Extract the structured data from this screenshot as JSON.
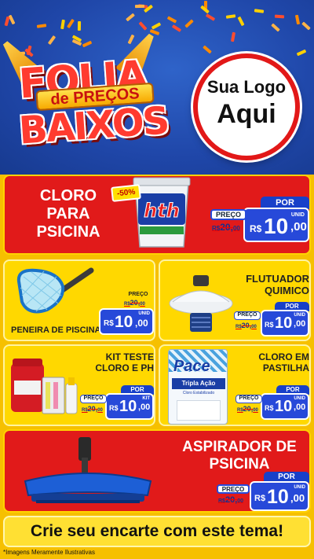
{
  "header": {
    "title_line1": "FOLIA",
    "title_ribbon": "de PREÇOS",
    "title_line2": "BAIXOS",
    "logo_line1": "Sua Logo",
    "logo_line2": "Aqui"
  },
  "products": [
    {
      "name_lines": [
        "CLORO",
        "PARA",
        "PSICINA"
      ],
      "discount": "-50%",
      "tag": {
        "por": "POR",
        "preco": "PREÇO",
        "old_currency": "R$",
        "old_int": "20",
        "old_dec": "00",
        "new_currency": "R$",
        "new_int": "10",
        "new_dec": "00",
        "unit": "UNID"
      },
      "colors": {
        "panel": "#e11a1a",
        "text": "#ffffff"
      }
    },
    {
      "name_lines": [
        "PENEIRA DE PISCINA"
      ],
      "tag": {
        "por": "POR",
        "preco": "PREÇO",
        "old_currency": "R$",
        "old_int": "20",
        "old_dec": "00",
        "new_currency": "R$",
        "new_int": "10",
        "new_dec": "00",
        "unit": "UNID"
      }
    },
    {
      "name_lines": [
        "FLUTUADOR",
        "QUIMICO"
      ],
      "tag": {
        "por": "POR",
        "preco": "PREÇO",
        "old_currency": "R$",
        "old_int": "20",
        "old_dec": "00",
        "new_currency": "R$",
        "new_int": "10",
        "new_dec": "00",
        "unit": "UNID"
      }
    },
    {
      "name_lines": [
        "KIT TESTE",
        "CLORO E PH"
      ],
      "tag": {
        "por": "POR",
        "preco": "PREÇO",
        "old_currency": "R$",
        "old_int": "20",
        "old_dec": "00",
        "new_currency": "R$",
        "new_int": "10",
        "new_dec": "00",
        "unit": "KIT"
      }
    },
    {
      "name_lines": [
        "CLORO EM",
        "PASTILHA"
      ],
      "tag": {
        "por": "POR",
        "preco": "PREÇO",
        "old_currency": "R$",
        "old_int": "20",
        "old_dec": "00",
        "new_currency": "R$",
        "new_int": "10",
        "new_dec": "00",
        "unit": "UNID"
      },
      "package": {
        "brand": "Pace",
        "line1": "Tripla Ação",
        "line2": "Cloro Estabilizado"
      }
    },
    {
      "name_lines": [
        "ASPIRADOR DE",
        "PSICINA"
      ],
      "tag": {
        "por": "POR",
        "preco": "PREÇO",
        "old_currency": "R$",
        "old_int": "20",
        "old_dec": "00",
        "new_currency": "R$",
        "new_int": "10",
        "new_dec": "00",
        "unit": "UNID"
      }
    }
  ],
  "bucket_brand": "hth",
  "footer": {
    "cta": "Crie seu encarte com este tema!",
    "disclaimer": "*Imagens Meramente Ilustrativas"
  },
  "colors": {
    "header_blue": "#1f46a8",
    "panel_red": "#e11a1a",
    "panel_yellow": "#ffd800",
    "page_yellow": "#f6c000",
    "price_blue": "#2749d9"
  }
}
